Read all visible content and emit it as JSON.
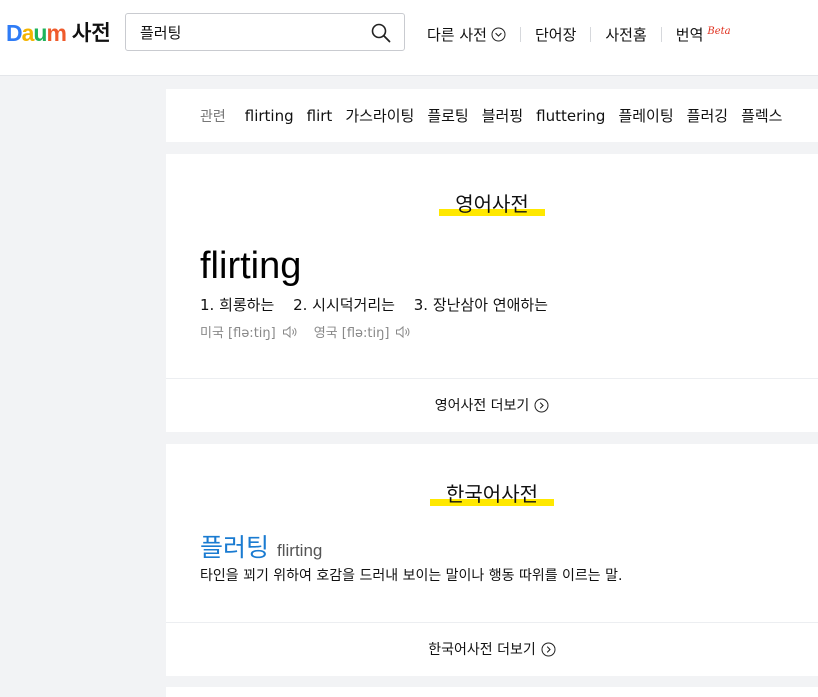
{
  "header": {
    "logo": [
      {
        "ch": "D",
        "color": "#2f7cf6"
      },
      {
        "ch": "a",
        "color": "#f4b400"
      },
      {
        "ch": "u",
        "color": "#1fb35b"
      },
      {
        "ch": "m",
        "color": "#ef5b2c"
      }
    ],
    "service_name": "사전",
    "search_value": "플러팅",
    "nav": [
      {
        "label": "다른 사전",
        "has_dropdown": true
      },
      {
        "label": "단어장"
      },
      {
        "label": "사전홈"
      },
      {
        "label": "번역",
        "badge": "Beta"
      }
    ]
  },
  "related": {
    "label": "관련",
    "items": [
      "flirting",
      "flirt",
      "가스라이팅",
      "플로팅",
      "블러핑",
      "fluttering",
      "플레이팅",
      "플러깅",
      "플렉스"
    ]
  },
  "english_dict": {
    "title": "영어사전",
    "word": "flirting",
    "meanings": [
      "1. 희롱하는",
      "2. 시시덕거리는",
      "3. 장난삼아 연애하는"
    ],
    "pronunciations": [
      {
        "label": "미국 [flə:tiŋ]"
      },
      {
        "label": "영국 [flə:tiŋ]"
      }
    ],
    "more_label": "영어사전 더보기"
  },
  "korean_dict": {
    "title": "한국어사전",
    "word": "플러팅",
    "origin": "flirting",
    "definition": "타인을 꾀기 위하여 호감을 드러내 보이는 말이나 행동 따위를 이르는 말.",
    "more_label": "한국어사전 더보기"
  },
  "colors": {
    "highlight": "#ffe800",
    "link_blue": "#1a7bd1",
    "beta_red": "#e0311f"
  }
}
